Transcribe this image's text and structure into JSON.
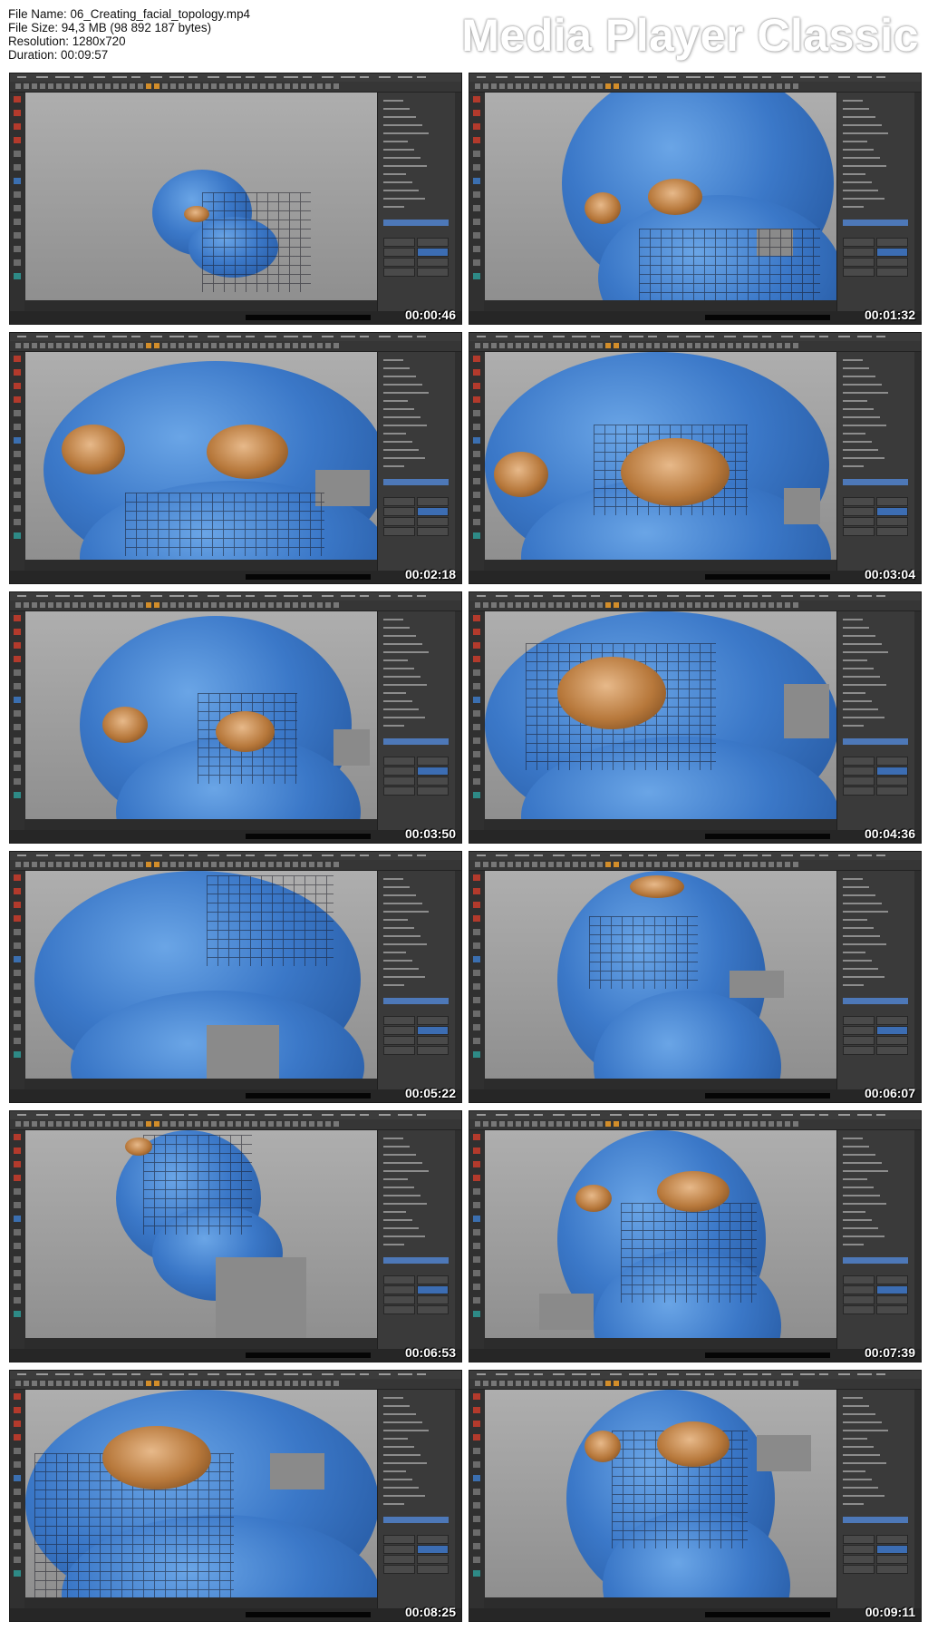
{
  "file_info": {
    "name_line": "File Name: 06_Creating_facial_topology.mp4",
    "size_line": "File Size: 94,3 MB (98 892 187 bytes)",
    "resolution_line": "Resolution: 1280x720",
    "duration_line": "Duration: 00:09:57"
  },
  "brand": "Media Player Classic",
  "thumbnails": [
    {
      "timestamp": "00:00:46",
      "view": "full-body"
    },
    {
      "timestamp": "00:01:32",
      "view": "head-front"
    },
    {
      "timestamp": "00:02:18",
      "view": "eyes-closeup"
    },
    {
      "timestamp": "00:03:04",
      "view": "eye-loop"
    },
    {
      "timestamp": "00:03:50",
      "view": "eye-loop-wide"
    },
    {
      "timestamp": "00:04:36",
      "view": "eye-side"
    },
    {
      "timestamp": "00:05:22",
      "view": "nose-mouth"
    },
    {
      "timestamp": "00:06:07",
      "view": "mouth-loop"
    },
    {
      "timestamp": "00:06:53",
      "view": "head-top"
    },
    {
      "timestamp": "00:07:39",
      "view": "face-topology"
    },
    {
      "timestamp": "00:08:25",
      "view": "face-side"
    },
    {
      "timestamp": "00:09:11",
      "view": "face-front"
    }
  ],
  "colors": {
    "model_blue": "#3b78c8",
    "eye_orange": "#b7783b",
    "ui_dark": "#2c2c2c",
    "viewport_gray": "#9e9e9e"
  }
}
